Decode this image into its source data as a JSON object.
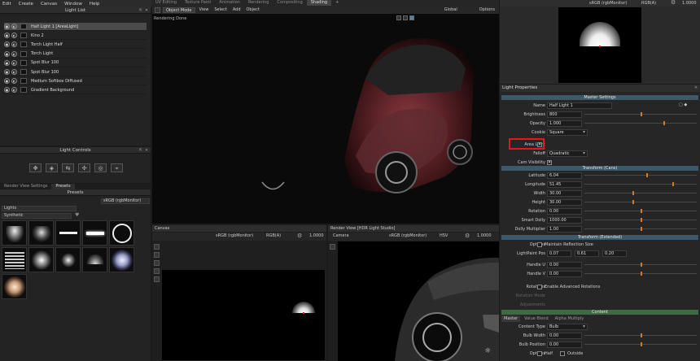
{
  "menu": [
    "Edit",
    "Create",
    "Canvas",
    "Window",
    "Help"
  ],
  "workspace_tabs": [
    "UV Editing",
    "Texture Paint",
    "Animation",
    "Rendering",
    "Compositing",
    "Shading",
    "+"
  ],
  "active_workspace_index": 5,
  "light_list": {
    "title": "Light List",
    "items": [
      {
        "label": "Half Light 1 [AreaLight]",
        "selected": true
      },
      {
        "label": "Kino 2"
      },
      {
        "label": "Torch Light Half"
      },
      {
        "label": "Torch Light"
      },
      {
        "label": "Spot Blur 100"
      },
      {
        "label": "Spot Blur 100"
      },
      {
        "label": "Medium Softbox Diffused"
      },
      {
        "label": "Gradient Background"
      }
    ]
  },
  "light_controls": {
    "title": "Light Controls"
  },
  "presets": {
    "tabs": [
      "Render View Settings",
      "Presets"
    ],
    "title": "Presets",
    "color_space": "sRGB (rgbMonitor)",
    "category": "Lights",
    "subcategory": "Synthetic"
  },
  "viewport": {
    "mode": "Object Mode",
    "menu": [
      "View",
      "Select",
      "Add",
      "Object"
    ],
    "orientation": "Global",
    "options": "Options",
    "status": "Rendering Done"
  },
  "canvas": {
    "title": "Canvas",
    "color_space": "sRGB (rgbMonitor)",
    "channel": "RGB(A)",
    "zoom": "1.0000"
  },
  "render_view": {
    "title": "Render View [HDR Light Studio]",
    "camera": "Camera",
    "color_space": "sRGB (rgbMonitor)",
    "mode": "HSV",
    "zoom": "1.0000"
  },
  "preview": {
    "color_space": "sRGB (rgbMonitor)",
    "channel": "RGB(A)",
    "zoom": "1.0000"
  },
  "props": {
    "title": "Light Properties",
    "master_settings": "Master Settings",
    "name_label": "Name",
    "name": "Half Light 1",
    "brightness_label": "Brightness",
    "brightness": "800",
    "opacity_label": "Opacity",
    "opacity": "1.000",
    "cookie_label": "Cookie",
    "cookie": "Square",
    "area_light_label": "Area Light",
    "falloff_label": "Falloff",
    "falloff": "Quadratic",
    "cam_vis_label": "Cam Visibility",
    "transform_cans": "Transform (Cans)",
    "latitude_label": "Latitude",
    "latitude": "6.04",
    "longitude_label": "Longitude",
    "longitude": "51.45",
    "width_label": "Width",
    "width": "30.00",
    "height_label": "Height",
    "height": "30.00",
    "rotation_label": "Rotation",
    "rotation": "0.00",
    "smart_dolly_label": "Smart Dolly",
    "smart_dolly": "1000.00",
    "dolly_mult_label": "Dolly Multiplier",
    "dolly_mult": "1.00",
    "transform_ext": "Transform (Extended)",
    "options_label": "Options",
    "maintain_reflection": "Maintain Reflection Size",
    "lightpaint_label": "LightPaint Pos",
    "lp_x": "0.07",
    "lp_y": "0.61",
    "lp_z": "0.20",
    "handle_u_label": "Handle U",
    "handle_u": "0.00",
    "handle_v_label": "Handle V",
    "handle_v": "0.00",
    "rotations_label": "Rotations",
    "adv_rotations": "Enable Advanced Rotations",
    "rotation_mode_label": "Rotation Mode",
    "adjustments_label": "Adjustments",
    "content": "Content",
    "content_tabs": [
      "Master",
      "Value Blend",
      "Alpha Multiply"
    ],
    "content_type_label": "Content Type",
    "content_type": "Bulb",
    "bulb_width_label": "Bulb Width",
    "bulb_width": "0.00",
    "bulb_position_label": "Bulb Position",
    "bulb_position": "0.00",
    "options2_label": "Options",
    "half_label": "Half",
    "outside_label": "Outside"
  },
  "slider_levels": {
    "brightness": 0.5,
    "opacity": 0.7,
    "latitude": 0.55,
    "longitude": 0.78,
    "width": 0.43,
    "height": 0.43,
    "rotation": 0.5,
    "smart_dolly": 0.5,
    "dolly_mult": 0.5,
    "handle_u": 0.5,
    "handle_v": 0.5,
    "bulb_width": 0.5,
    "bulb_position": 0.5
  }
}
